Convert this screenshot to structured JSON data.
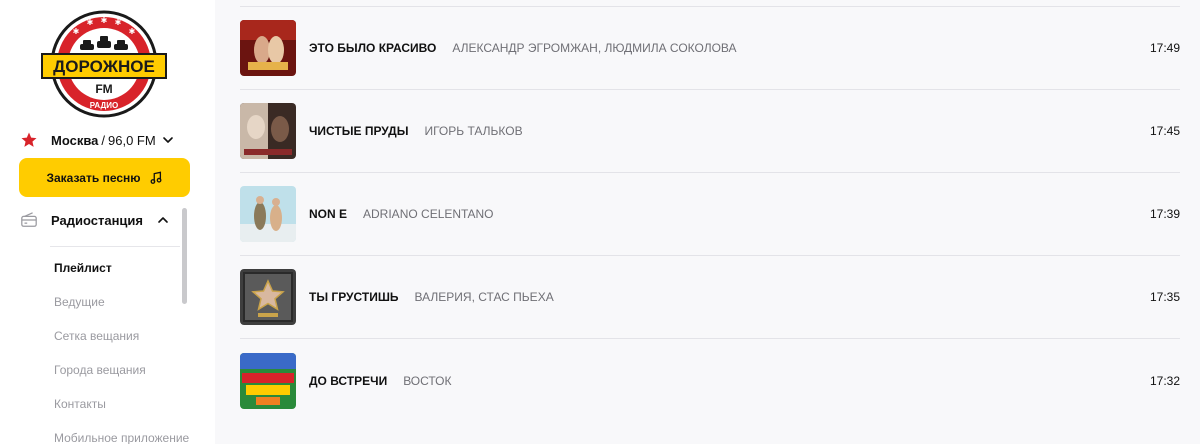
{
  "brand": {
    "logo_text": "ДОРОЖНОЕ",
    "logo_sub": "FM",
    "logo_arc": "РАДИО",
    "colors": {
      "red": "#d8232a",
      "yellow": "#ffcc00",
      "dark": "#1a1a1a"
    }
  },
  "city": {
    "name": "Москва",
    "separator": "/",
    "frequency": "96,0 FM",
    "icon": "star-icon"
  },
  "order_button": {
    "label": "Заказать песню",
    "icon": "music-note-icon"
  },
  "station_menu": {
    "label": "Радиостанция",
    "icon": "radio-icon",
    "items": [
      {
        "label": "Плейлист",
        "active": true
      },
      {
        "label": "Ведущие"
      },
      {
        "label": "Сетка вещания"
      },
      {
        "label": "Города вещания"
      },
      {
        "label": "Контакты"
      },
      {
        "label": "Мобильное приложение"
      }
    ]
  },
  "playlist": [
    {
      "title": "ЭТО БЫЛО КРАСИВО",
      "artist": "АЛЕКСАНДР ЭГРОМЖАН, ЛЮДМИЛА СОКОЛОВА",
      "time": "17:49"
    },
    {
      "title": "ЧИСТЫЕ ПРУДЫ",
      "artist": "ИГОРЬ ТАЛЬКОВ",
      "time": "17:45"
    },
    {
      "title": "NON E",
      "artist": "ADRIANO CELENTANO",
      "time": "17:39"
    },
    {
      "title": "ТЫ ГРУСТИШЬ",
      "artist": "ВАЛЕРИЯ, СТАС ПЬЕХА",
      "time": "17:35"
    },
    {
      "title": "ДО ВСТРЕЧИ",
      "artist": "ВОСТОК",
      "time": "17:32"
    }
  ]
}
